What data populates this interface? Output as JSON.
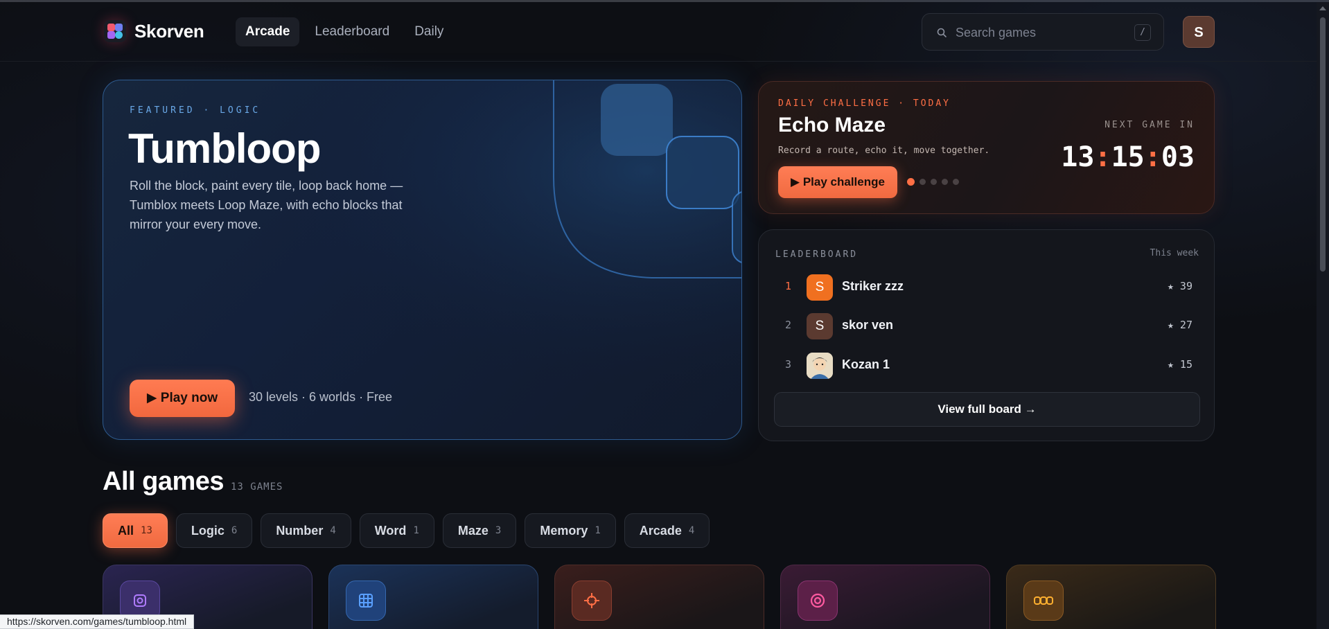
{
  "brand": {
    "name": "Skorven"
  },
  "nav": {
    "items": [
      "Arcade",
      "Leaderboard",
      "Daily"
    ]
  },
  "search": {
    "placeholder": "Search games",
    "shortcut": "/"
  },
  "user": {
    "initial": "S"
  },
  "featured": {
    "eyebrow": "FEATURED · LOGIC",
    "title": "Tumbloop",
    "description": "Roll the block, paint every tile, loop back home — Tumblox meets Loop Maze, with echo blocks that mirror your every move.",
    "play_label": "▶ Play now",
    "meta": "30 levels · 6 worlds · Free"
  },
  "daily": {
    "eyebrow": "DAILY CHALLENGE · TODAY",
    "title": "Echo Maze",
    "subtitle": "Record a route, echo it, move together.",
    "play_label": "▶ Play challenge",
    "next_label": "NEXT GAME IN",
    "countdown": {
      "hours": "13",
      "minutes": "15",
      "seconds": "03",
      "separator": ":"
    },
    "dots_total": 5,
    "dot_active": 1
  },
  "leaderboard": {
    "title": "LEADERBOARD",
    "period": "This week",
    "rows": [
      {
        "rank": "1",
        "initial": "S",
        "name": "Striker zzz",
        "score": "★ 39",
        "avatar_color": "#f07020"
      },
      {
        "rank": "2",
        "initial": "S",
        "name": "skor ven",
        "score": "★ 27",
        "avatar_color": "#5b3a30"
      },
      {
        "rank": "3",
        "initial": "",
        "name": "Kozan 1",
        "score": "★ 15",
        "avatar_color": "#d8c8a8"
      }
    ],
    "view_label": "View full board →"
  },
  "games": {
    "title": "All games",
    "count": "13 GAMES",
    "filters": [
      {
        "label": "All",
        "count": "13"
      },
      {
        "label": "Logic",
        "count": "6"
      },
      {
        "label": "Number",
        "count": "4"
      },
      {
        "label": "Word",
        "count": "1"
      },
      {
        "label": "Maze",
        "count": "3"
      },
      {
        "label": "Memory",
        "count": "1"
      },
      {
        "label": "Arcade",
        "count": "4"
      }
    ],
    "cards": [
      {
        "icon": "square-target-icon",
        "color": "#a466f2"
      },
      {
        "icon": "grid-icon",
        "color": "#4a8ef0"
      },
      {
        "icon": "crosshair-icon",
        "color": "#ff6f45"
      },
      {
        "icon": "ring-icon",
        "color": "#f0508c"
      },
      {
        "icon": "chain-icon",
        "color": "#f0a030"
      }
    ]
  },
  "status_url": "https://skorven.com/games/tumbloop.html"
}
